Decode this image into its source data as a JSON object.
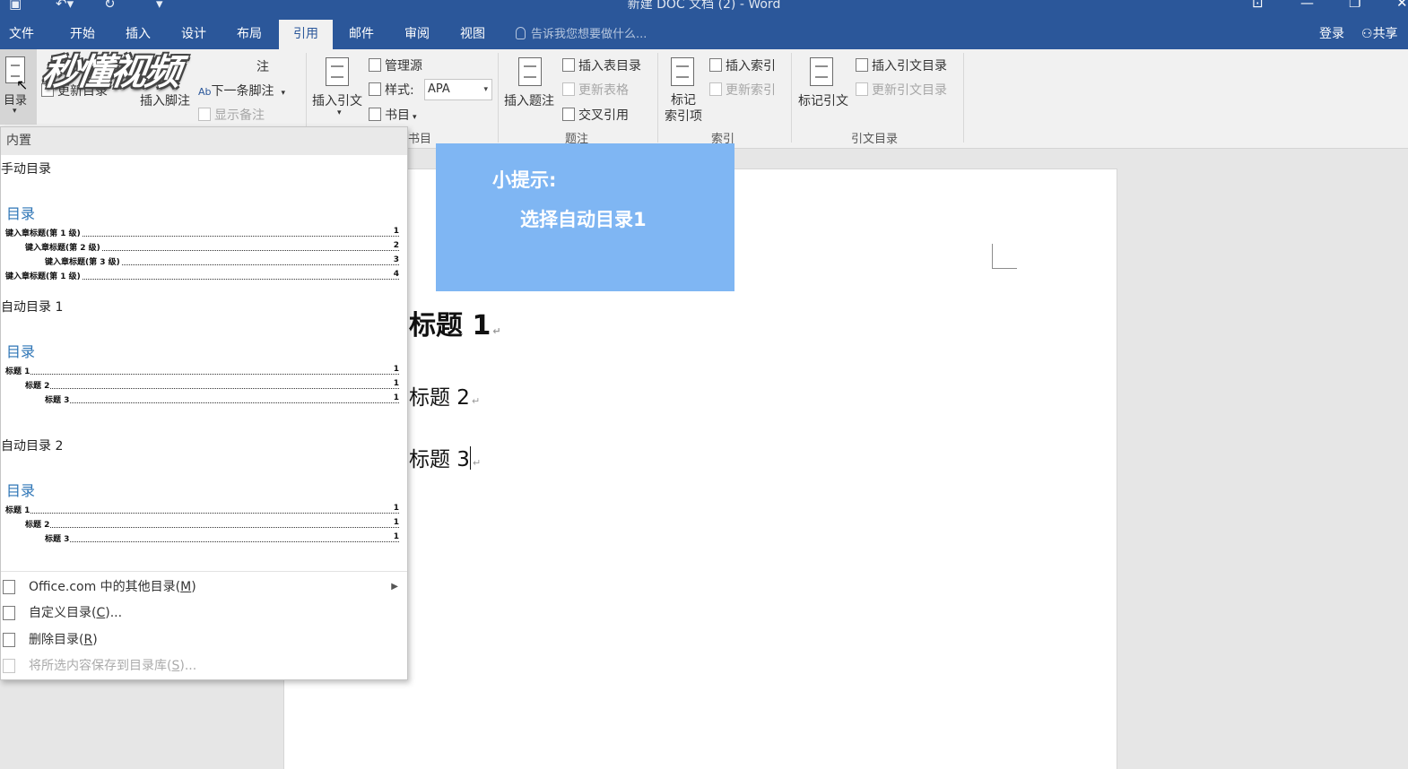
{
  "window": {
    "title": "新建 DOC 文档 (2) - Word"
  },
  "tabs": [
    "文件",
    "开始",
    "插入",
    "设计",
    "布局",
    "引用",
    "邮件",
    "审阅",
    "视图"
  ],
  "active_tab": "引用",
  "tell_me": "告诉我您想要做什么...",
  "account": {
    "login": "登录",
    "share": "共享"
  },
  "ribbon": {
    "toc_button": "目录",
    "update_toc": "更新目录",
    "insert_footnote_partial": "注",
    "insert_footnote": "插入脚注",
    "next_footnote": "下一条脚注",
    "show_notes": "显示备注",
    "insert_citation": "插入引文",
    "manage_sources": "管理源",
    "style_label": "样式:",
    "style_value": "APA",
    "bibliography": "书目",
    "insert_caption": "插入题注",
    "insert_table_of_figures": "插入表目录",
    "update_table": "更新表格",
    "cross_reference": "交叉引用",
    "mark_entry_line1": "标记",
    "mark_entry_line2": "索引项",
    "insert_index": "插入索引",
    "update_index": "更新索引",
    "mark_citation": "标记引文",
    "insert_toa": "插入引文目录",
    "update_toa": "更新引文目录",
    "groups": {
      "citations": "书目",
      "captions": "题注",
      "index": "索引",
      "toa": "引文目录"
    }
  },
  "watermark": "秒懂视频",
  "tip": {
    "title": "小提示:",
    "text": "选择自动目录1"
  },
  "document": {
    "h1": "标题 1",
    "h2": "标题 2",
    "h3": "标题 3"
  },
  "gallery": {
    "header": "内置",
    "sections": [
      {
        "name": "手动目录",
        "toc_title": "目录",
        "entries": [
          {
            "text": "键入章标题(第 1 级)",
            "page": "1",
            "level": 1
          },
          {
            "text": "键入章标题(第 2 级)",
            "page": "2",
            "level": 2
          },
          {
            "text": "键入章标题(第 3 级)",
            "page": "3",
            "level": 3
          },
          {
            "text": "键入章标题(第 1 级)",
            "page": "4",
            "level": 1
          }
        ]
      },
      {
        "name": "自动目录 1",
        "toc_title": "目录",
        "entries": [
          {
            "text": "标题 1",
            "page": "1",
            "level": 1
          },
          {
            "text": "标题 2",
            "page": "1",
            "level": 2
          },
          {
            "text": "标题 3",
            "page": "1",
            "level": 3
          }
        ]
      },
      {
        "name": "自动目录 2",
        "toc_title": "目录",
        "entries": [
          {
            "text": "标题 1",
            "page": "1",
            "level": 1
          },
          {
            "text": "标题 2",
            "page": "1",
            "level": 2
          },
          {
            "text": "标题 3",
            "page": "1",
            "level": 3
          }
        ]
      }
    ],
    "menu": [
      {
        "label": "Office.com 中的其他目录(",
        "key": "M",
        "suffix": ")",
        "submenu": true,
        "disabled": false
      },
      {
        "label": "自定义目录(",
        "key": "C",
        "suffix": ")...",
        "submenu": false,
        "disabled": false
      },
      {
        "label": "删除目录(",
        "key": "R",
        "suffix": ")",
        "submenu": false,
        "disabled": false
      },
      {
        "label": "将所选内容保存到目录库(",
        "key": "S",
        "suffix": ")...",
        "submenu": false,
        "disabled": true
      }
    ]
  },
  "colors": {
    "brand": "#2b579a",
    "tip_bg": "#7fb6f3",
    "toc_title": "#2e75b6"
  }
}
